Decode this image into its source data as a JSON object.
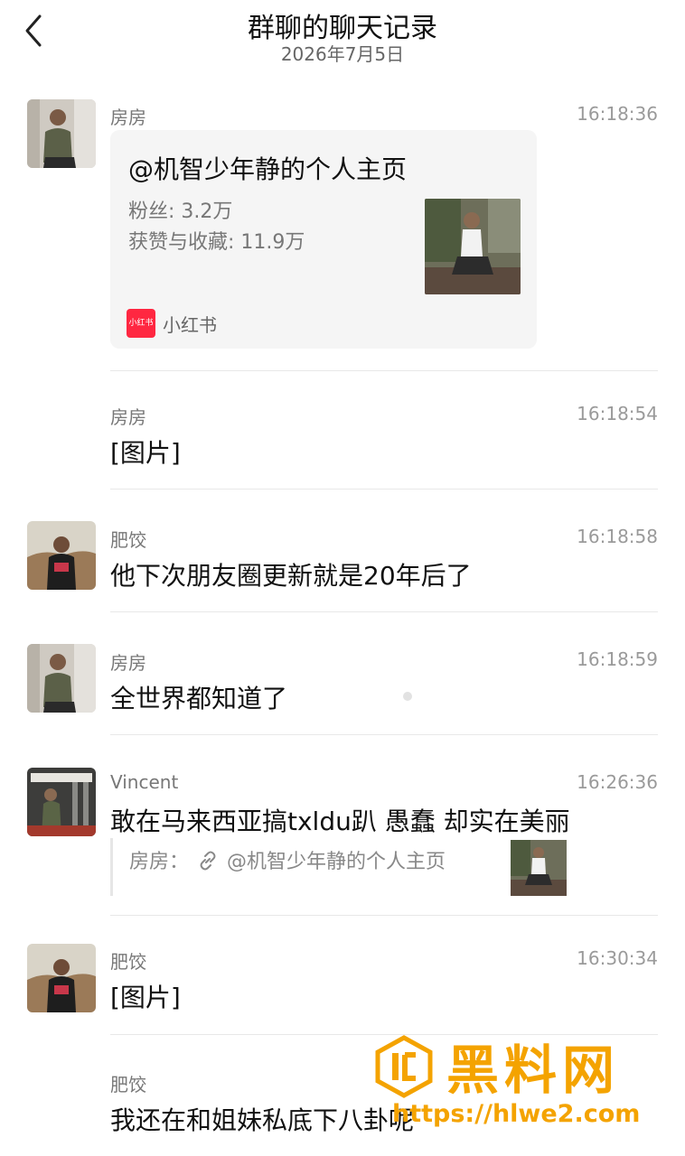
{
  "header": {
    "title": "群聊的聊天记录",
    "date": "2026年7月5日"
  },
  "messages": [
    {
      "sender": "房房",
      "time": "16:18:36",
      "card": {
        "title": "@机智少年静的个人主页",
        "fans": "粉丝: 3.2万",
        "likes": "获赞与收藏: 11.9万",
        "source": "小红书",
        "source_logo_text": "小红书"
      }
    },
    {
      "sender": "房房",
      "time": "16:18:54",
      "text": "[图片]"
    },
    {
      "sender": "肥饺",
      "time": "16:18:58",
      "text": "他下次朋友圈更新就是20年后了"
    },
    {
      "sender": "房房",
      "time": "16:18:59",
      "text": "全世界都知道了"
    },
    {
      "sender": "Vincent",
      "time": "16:26:36",
      "text": "敢在马来西亚搞txldu趴 愚蠢 却实在美丽",
      "quote": {
        "author": "房房：",
        "text": "@机智少年静的个人主页"
      }
    },
    {
      "sender": "肥饺",
      "time": "16:30:34",
      "text": "[图片]"
    },
    {
      "sender": "肥饺",
      "time": "",
      "text": "我还在和姐妹私底下八卦呢"
    }
  ],
  "watermark": {
    "brand": "黑料网",
    "url": "https://hlwe2.com"
  },
  "colors": {
    "accent": "#f4a300",
    "xhs_red": "#ff2741"
  }
}
